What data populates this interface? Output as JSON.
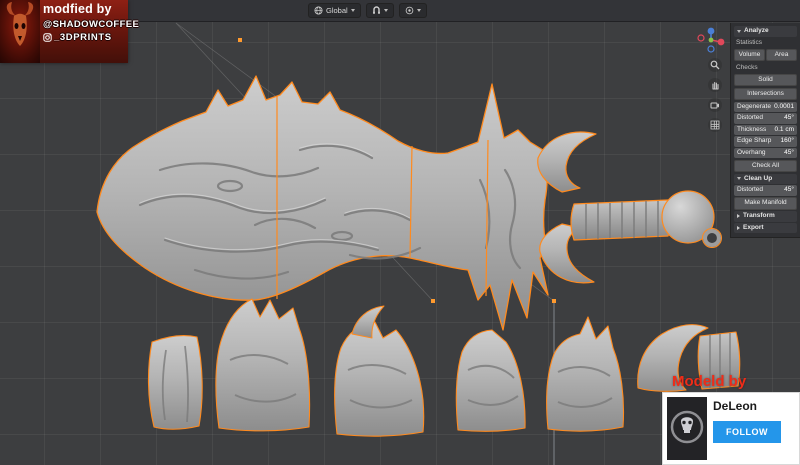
{
  "viewport": {
    "header": {
      "orientation_label": "Global"
    }
  },
  "watermark_top": {
    "line1": "modfied by",
    "handle": "@SHADOWCOFFEE",
    "handle2": "_3DPRINTS"
  },
  "watermark_bottom": {
    "title": "Modeld by",
    "name": "DeLeon",
    "follow_label": "FOLLOW"
  },
  "panel": {
    "analyze": {
      "title": "Analyze",
      "statistics_label": "Statistics",
      "volume_label": "Volume",
      "area_label": "Area",
      "checks_label": "Checks",
      "solid_label": "Solid",
      "intersections_label": "Intersections",
      "rows": [
        {
          "label": "Degenerate",
          "value": "0.0001"
        },
        {
          "label": "Distorted",
          "value": "45°"
        },
        {
          "label": "Thickness",
          "value": "0.1 cm"
        },
        {
          "label": "Edge Sharp",
          "value": "160°"
        },
        {
          "label": "Overhang",
          "value": "45°"
        }
      ],
      "check_all_label": "Check All"
    },
    "cleanup": {
      "title": "Clean Up",
      "row": {
        "label": "Distorted",
        "value": "45°"
      },
      "make_manifold_label": "Make Manifold"
    },
    "transform_title": "Transform",
    "export_title": "Export"
  },
  "icons": {
    "orientation": "globe-icon",
    "snapping": "magnet-icon",
    "proportional": "proportional-circle-icon",
    "zoom": "magnifier-icon",
    "pan": "hand-icon",
    "camera": "camera-icon",
    "grid": "grid-icon",
    "social": "instagram-icon"
  },
  "colors": {
    "selection_orange": "#ff8a1e",
    "follow_blue": "#2496ea",
    "watermark_red": "#ef2c18",
    "viewport_bg": "#3d3e40"
  }
}
